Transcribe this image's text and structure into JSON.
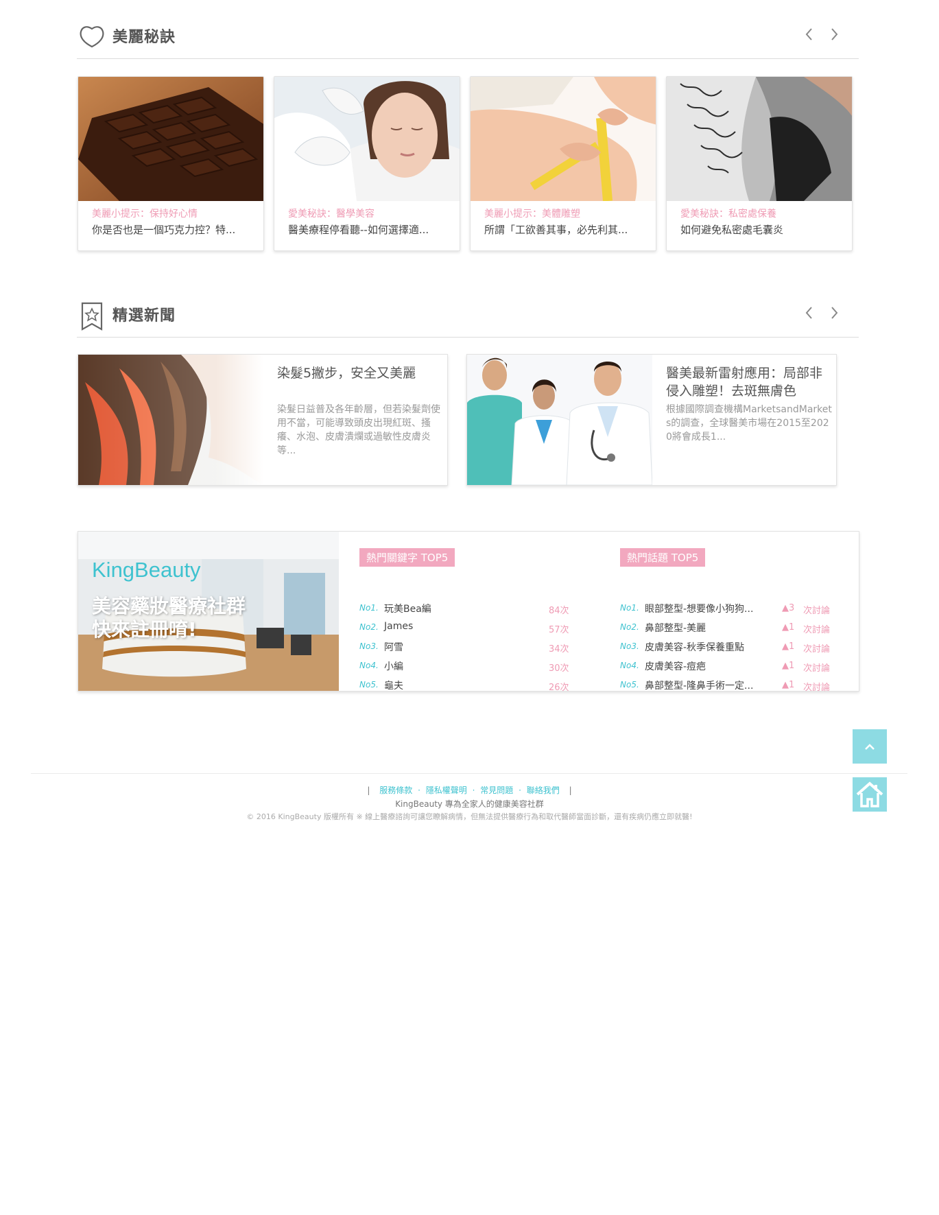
{
  "beauty_section": {
    "title": "美麗秘訣",
    "icon": "heart-outline-icon",
    "cards": [
      {
        "category": "美麗小提示：保持好心情",
        "title": "你是否也是一個巧克力控？特...",
        "image": "chocolate-photo"
      },
      {
        "category": "愛美秘訣：醫學美容",
        "title": "醫美療程停看聽--如何選擇適...",
        "image": "facial-injection-photo"
      },
      {
        "category": "美麗小提示：美體雕塑",
        "title": "所謂「工欲善其事，必先利其...",
        "image": "measuring-tape-photo"
      },
      {
        "category": "愛美秘訣：私密處保養",
        "title": "如何避免私密處毛囊炎",
        "image": "lace-lingerie-photo"
      }
    ]
  },
  "news_section": {
    "title": "精選新聞",
    "icon": "star-bookmark-icon",
    "cards": [
      {
        "title": "染髮5撇步，安全又美麗",
        "desc": "染髮日益普及各年齡層，但若染髮劑使用不當，可能導致頭皮出現紅斑、搔癢、水泡、皮膚潰爛或過敏性皮膚炎等...",
        "image": "dyed-hair-photo"
      },
      {
        "title": "醫美最新雷射應用：局部非侵入雕塑！去斑無膚色",
        "desc": "根據國際調查機構MarketsandMarkets的調查，全球醫美市場在2015至2020將會成長1...",
        "image": "doctors-team-photo"
      }
    ]
  },
  "community": {
    "brand": "KingBeauty",
    "tagline_line1": "美容藥妝醫療社群",
    "tagline_line2": "快來註冊唷!",
    "keywords": {
      "title": "熱門關鍵字 TOP5",
      "items": [
        {
          "rank": "No1.",
          "name": "玩美Bea編",
          "count": "84次"
        },
        {
          "rank": "No2.",
          "name": "James",
          "count": "57次"
        },
        {
          "rank": "No3.",
          "name": "阿雪",
          "count": "34次"
        },
        {
          "rank": "No4.",
          "name": "小編",
          "count": "30次"
        },
        {
          "rank": "No5.",
          "name": "龜夫",
          "count": "26次"
        }
      ]
    },
    "topics": {
      "title": "熱門話題 TOP5",
      "items": [
        {
          "rank": "No1.",
          "name": "眼部整型-想要像小狗狗...",
          "delta": "▲3",
          "discuss": "次討論"
        },
        {
          "rank": "No2.",
          "name": "鼻部整型-美麗",
          "delta": "▲1",
          "discuss": "次討論"
        },
        {
          "rank": "No3.",
          "name": "皮膚美容-秋季保養重點",
          "delta": "▲1",
          "discuss": "次討論"
        },
        {
          "rank": "No4.",
          "name": "皮膚美容-痘疤",
          "delta": "▲1",
          "discuss": "次討論"
        },
        {
          "rank": "No5.",
          "name": "鼻部整型-隆鼻手術一定...",
          "delta": "▲1",
          "discuss": "次討論"
        }
      ]
    }
  },
  "floating": {
    "back_to_top_icon": "chevron-up-icon",
    "home_icon": "home-icon"
  },
  "footer": {
    "links": [
      "服務條款",
      "隱私權聲明",
      "常見問題",
      "聯絡我們"
    ],
    "tagline": "KingBeauty 專為全家人的健康美容社群",
    "copyright": "© 2016 KingBeauty 版權所有 ※ 線上醫療諮詢可讓您瞭解病情，但無法提供醫療行為和取代醫師當面診斷，還有疾病仍應立即就醫!"
  },
  "colors": {
    "accent_pink": "#ef9bb4",
    "badge_pink": "#f2a8bf",
    "accent_teal": "#3ec2cf",
    "float_button": "#8ddbe3"
  }
}
